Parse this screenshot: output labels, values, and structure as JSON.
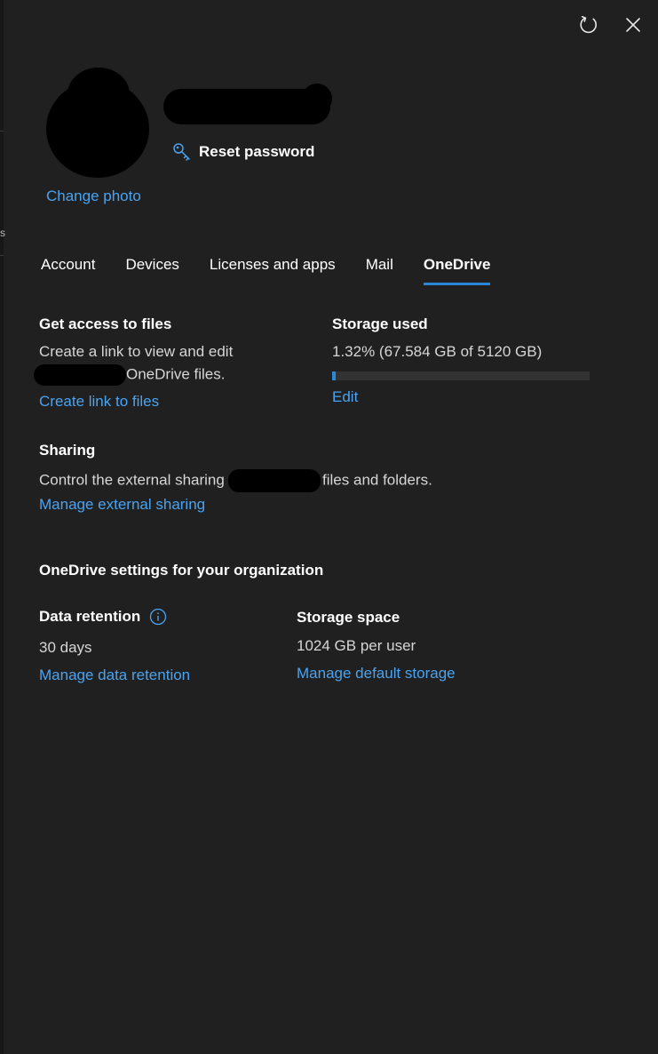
{
  "header": {
    "reset_password": "Reset password",
    "change_photo": "Change photo"
  },
  "tabs": [
    {
      "label": "Account"
    },
    {
      "label": "Devices"
    },
    {
      "label": "Licenses and apps"
    },
    {
      "label": "Mail"
    },
    {
      "label": "OneDrive"
    }
  ],
  "files": {
    "heading": "Get access to files",
    "line1": "Create a link to view and edit",
    "line2_suffix": "OneDrive files.",
    "link": "Create link to files"
  },
  "storage": {
    "heading": "Storage used",
    "value_text": "1.32% (67.584 GB of 5120 GB)",
    "percent_used": 1.32,
    "link": "Edit"
  },
  "sharing": {
    "heading": "Sharing",
    "text_prefix": "Control the external sharing o",
    "text_suffix": "files and folders.",
    "link": "Manage external sharing"
  },
  "org_settings": {
    "heading": "OneDrive settings for your organization",
    "retention": {
      "label": "Data retention",
      "value": "30 days",
      "link": "Manage data retention"
    },
    "storage_space": {
      "label": "Storage space",
      "value": "1024 GB per user",
      "link": "Manage default storage"
    }
  },
  "colors": {
    "background": "#202020",
    "accent": "#2b88d8",
    "link": "#4aa3f0"
  },
  "icons": [
    "refresh-icon",
    "close-icon",
    "key-icon",
    "info-icon"
  ]
}
